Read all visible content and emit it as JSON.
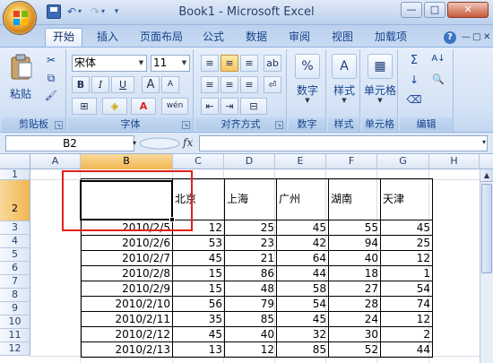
{
  "window": {
    "title": "Book1 - Microsoft Excel",
    "minimize_glyph": "—",
    "maximize_glyph": "□",
    "close_glyph": "✕"
  },
  "quick_access": {
    "undo_glyph": "↶",
    "redo_glyph": "↷",
    "dropdown_glyph": "▾"
  },
  "ribbon_tabs": [
    {
      "label": "开始",
      "active": true
    },
    {
      "label": "插入"
    },
    {
      "label": "页面布局"
    },
    {
      "label": "公式"
    },
    {
      "label": "数据"
    },
    {
      "label": "审阅"
    },
    {
      "label": "视图"
    },
    {
      "label": "加载项"
    }
  ],
  "ribbon_help_glyph": "?",
  "ribbon": {
    "clipboard": {
      "label": "剪贴板",
      "paste_label": "粘贴",
      "cut_glyph": "✂",
      "copy_glyph": "⧉",
      "painter_glyph": "🖌"
    },
    "font": {
      "label": "字体",
      "font_name": "宋体",
      "font_size": "11",
      "bold": "B",
      "italic": "I",
      "underline": "U",
      "grow": "A",
      "shrink": "A",
      "border_glyph": "⊞",
      "fill_glyph": "◈",
      "color_glyph": "A",
      "phonetic_glyph": "wén",
      "font_color": "#e02020",
      "fill_color": "#ffee00"
    },
    "alignment": {
      "label": "对齐方式",
      "top": "≡",
      "middle": "≡",
      "bottom": "≡",
      "left": "≡",
      "center": "≡",
      "right": "≡",
      "indent_dec": "⇤",
      "indent_inc": "⇥",
      "orient": "ab",
      "wrap": "⏎",
      "merge": "⊟"
    },
    "number": {
      "label": "数字",
      "icon": "%"
    },
    "styles": {
      "label": "样式",
      "icon": "A"
    },
    "cells": {
      "label": "单元格",
      "icon": "▦"
    },
    "editing": {
      "label": "编辑",
      "sum": "Σ",
      "sort": "A↓",
      "fill": "↓",
      "find": "🔍",
      "clear": "⌫"
    }
  },
  "formula_bar": {
    "name_box": "B2",
    "fx": "fx",
    "formula": "",
    "collapse_glyph": "▾",
    "dropdown_glyph": "▾"
  },
  "columns": [
    "A",
    "B",
    "C",
    "D",
    "E",
    "F",
    "G",
    "H"
  ],
  "rows": [
    "1",
    "2",
    "3",
    "4",
    "5",
    "6",
    "7",
    "8",
    "9",
    "10",
    "11",
    "12"
  ],
  "active_cell": "B2",
  "sheet": {
    "header_cities": [
      "北京",
      "上海",
      "广州",
      "湖南",
      "天津"
    ],
    "rows": [
      {
        "date": "2010/2/5",
        "values": [
          "12",
          "25",
          "45",
          "55",
          "45"
        ]
      },
      {
        "date": "2010/2/6",
        "values": [
          "53",
          "23",
          "42",
          "94",
          "25"
        ]
      },
      {
        "date": "2010/2/7",
        "values": [
          "45",
          "21",
          "64",
          "40",
          "12"
        ]
      },
      {
        "date": "2010/2/8",
        "values": [
          "15",
          "86",
          "44",
          "18",
          "1"
        ]
      },
      {
        "date": "2010/2/9",
        "values": [
          "15",
          "48",
          "58",
          "27",
          "54"
        ]
      },
      {
        "date": "2010/2/10",
        "values": [
          "56",
          "79",
          "54",
          "28",
          "74"
        ]
      },
      {
        "date": "2010/2/11",
        "values": [
          "35",
          "85",
          "45",
          "24",
          "12"
        ]
      },
      {
        "date": "2010/2/12",
        "values": [
          "45",
          "40",
          "32",
          "30",
          "2"
        ]
      },
      {
        "date": "2010/2/13",
        "values": [
          "13",
          "12",
          "85",
          "52",
          "44"
        ]
      }
    ]
  },
  "colors": {
    "selection_highlight": "#e0201c",
    "ribbon_text": "#15428b"
  },
  "scrollbar_up_glyph": "▲"
}
